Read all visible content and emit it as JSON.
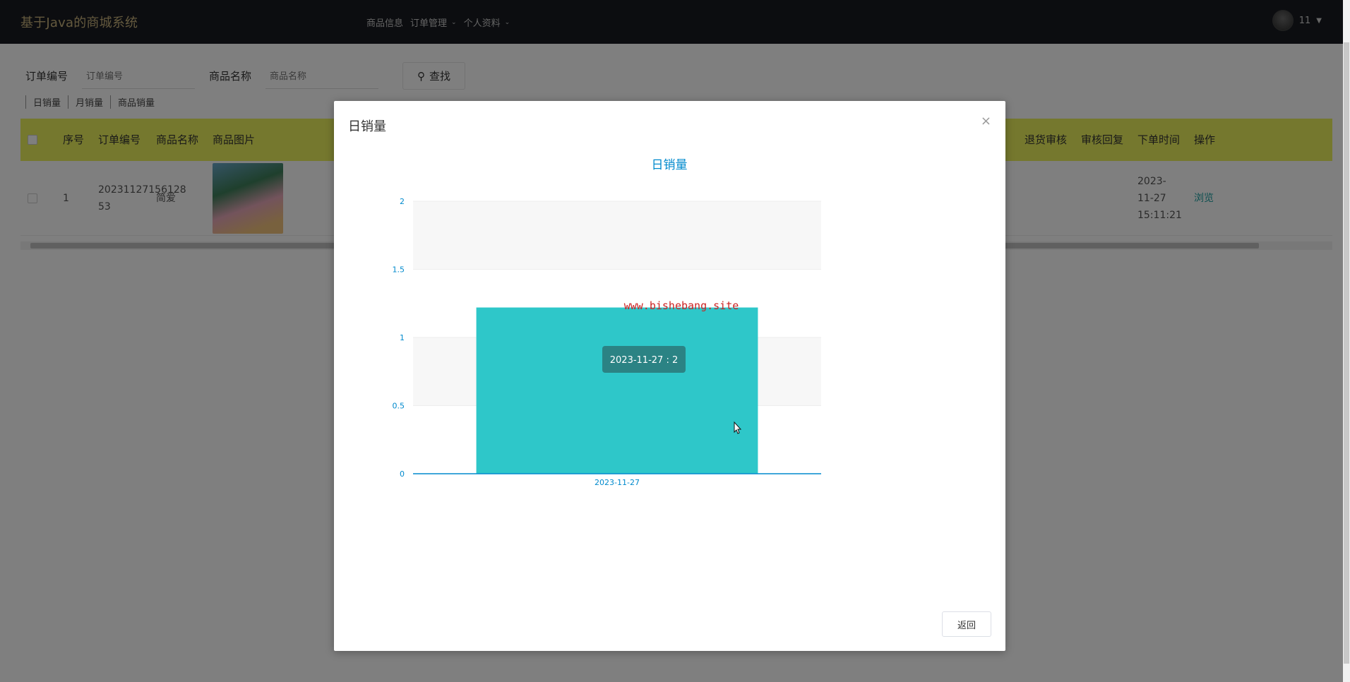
{
  "header": {
    "brand": "基于Java的商城系统",
    "nav": [
      {
        "label": "商品信息",
        "dropdown": false
      },
      {
        "label": "订单管理",
        "dropdown": true
      },
      {
        "label": "个人资料",
        "dropdown": true
      }
    ],
    "user": "11"
  },
  "search": {
    "order_no_label": "订单编号",
    "order_no_placeholder": "订单编号",
    "product_name_label": "商品名称",
    "product_name_placeholder": "商品名称",
    "button_label": "查找"
  },
  "tabs": [
    "日销量",
    "月销量",
    "商品销量"
  ],
  "table": {
    "columns": [
      "序号",
      "订单编号",
      "商品名称",
      "商品图片",
      "退货审核",
      "审核回复",
      "下单时间",
      "操作"
    ],
    "rows": [
      {
        "index": "1",
        "order_no": "20231127156128 53",
        "product_name": "简爱",
        "order_time": "2023-11-27 15:11:21",
        "action": "浏览"
      }
    ]
  },
  "modal": {
    "title": "日销量",
    "close_label": "×",
    "back_label": "返回",
    "watermark": "www.bishebang.site",
    "tooltip": "2023-11-27 : 2"
  },
  "colors": {
    "accent": "#2ec7c9",
    "header_bg": "#181b21",
    "table_header_bg": "#eaf05c",
    "chart_axis": "#008acd",
    "watermark": "#cc2222"
  },
  "chart_data": {
    "type": "bar",
    "title": "日销量",
    "categories": [
      "2023-11-27"
    ],
    "values": [
      2
    ],
    "y_ticks": [
      0,
      0.5,
      1,
      1.5,
      2
    ],
    "ylim": [
      0,
      2
    ],
    "grid": true,
    "xlabel": "",
    "ylabel": ""
  }
}
